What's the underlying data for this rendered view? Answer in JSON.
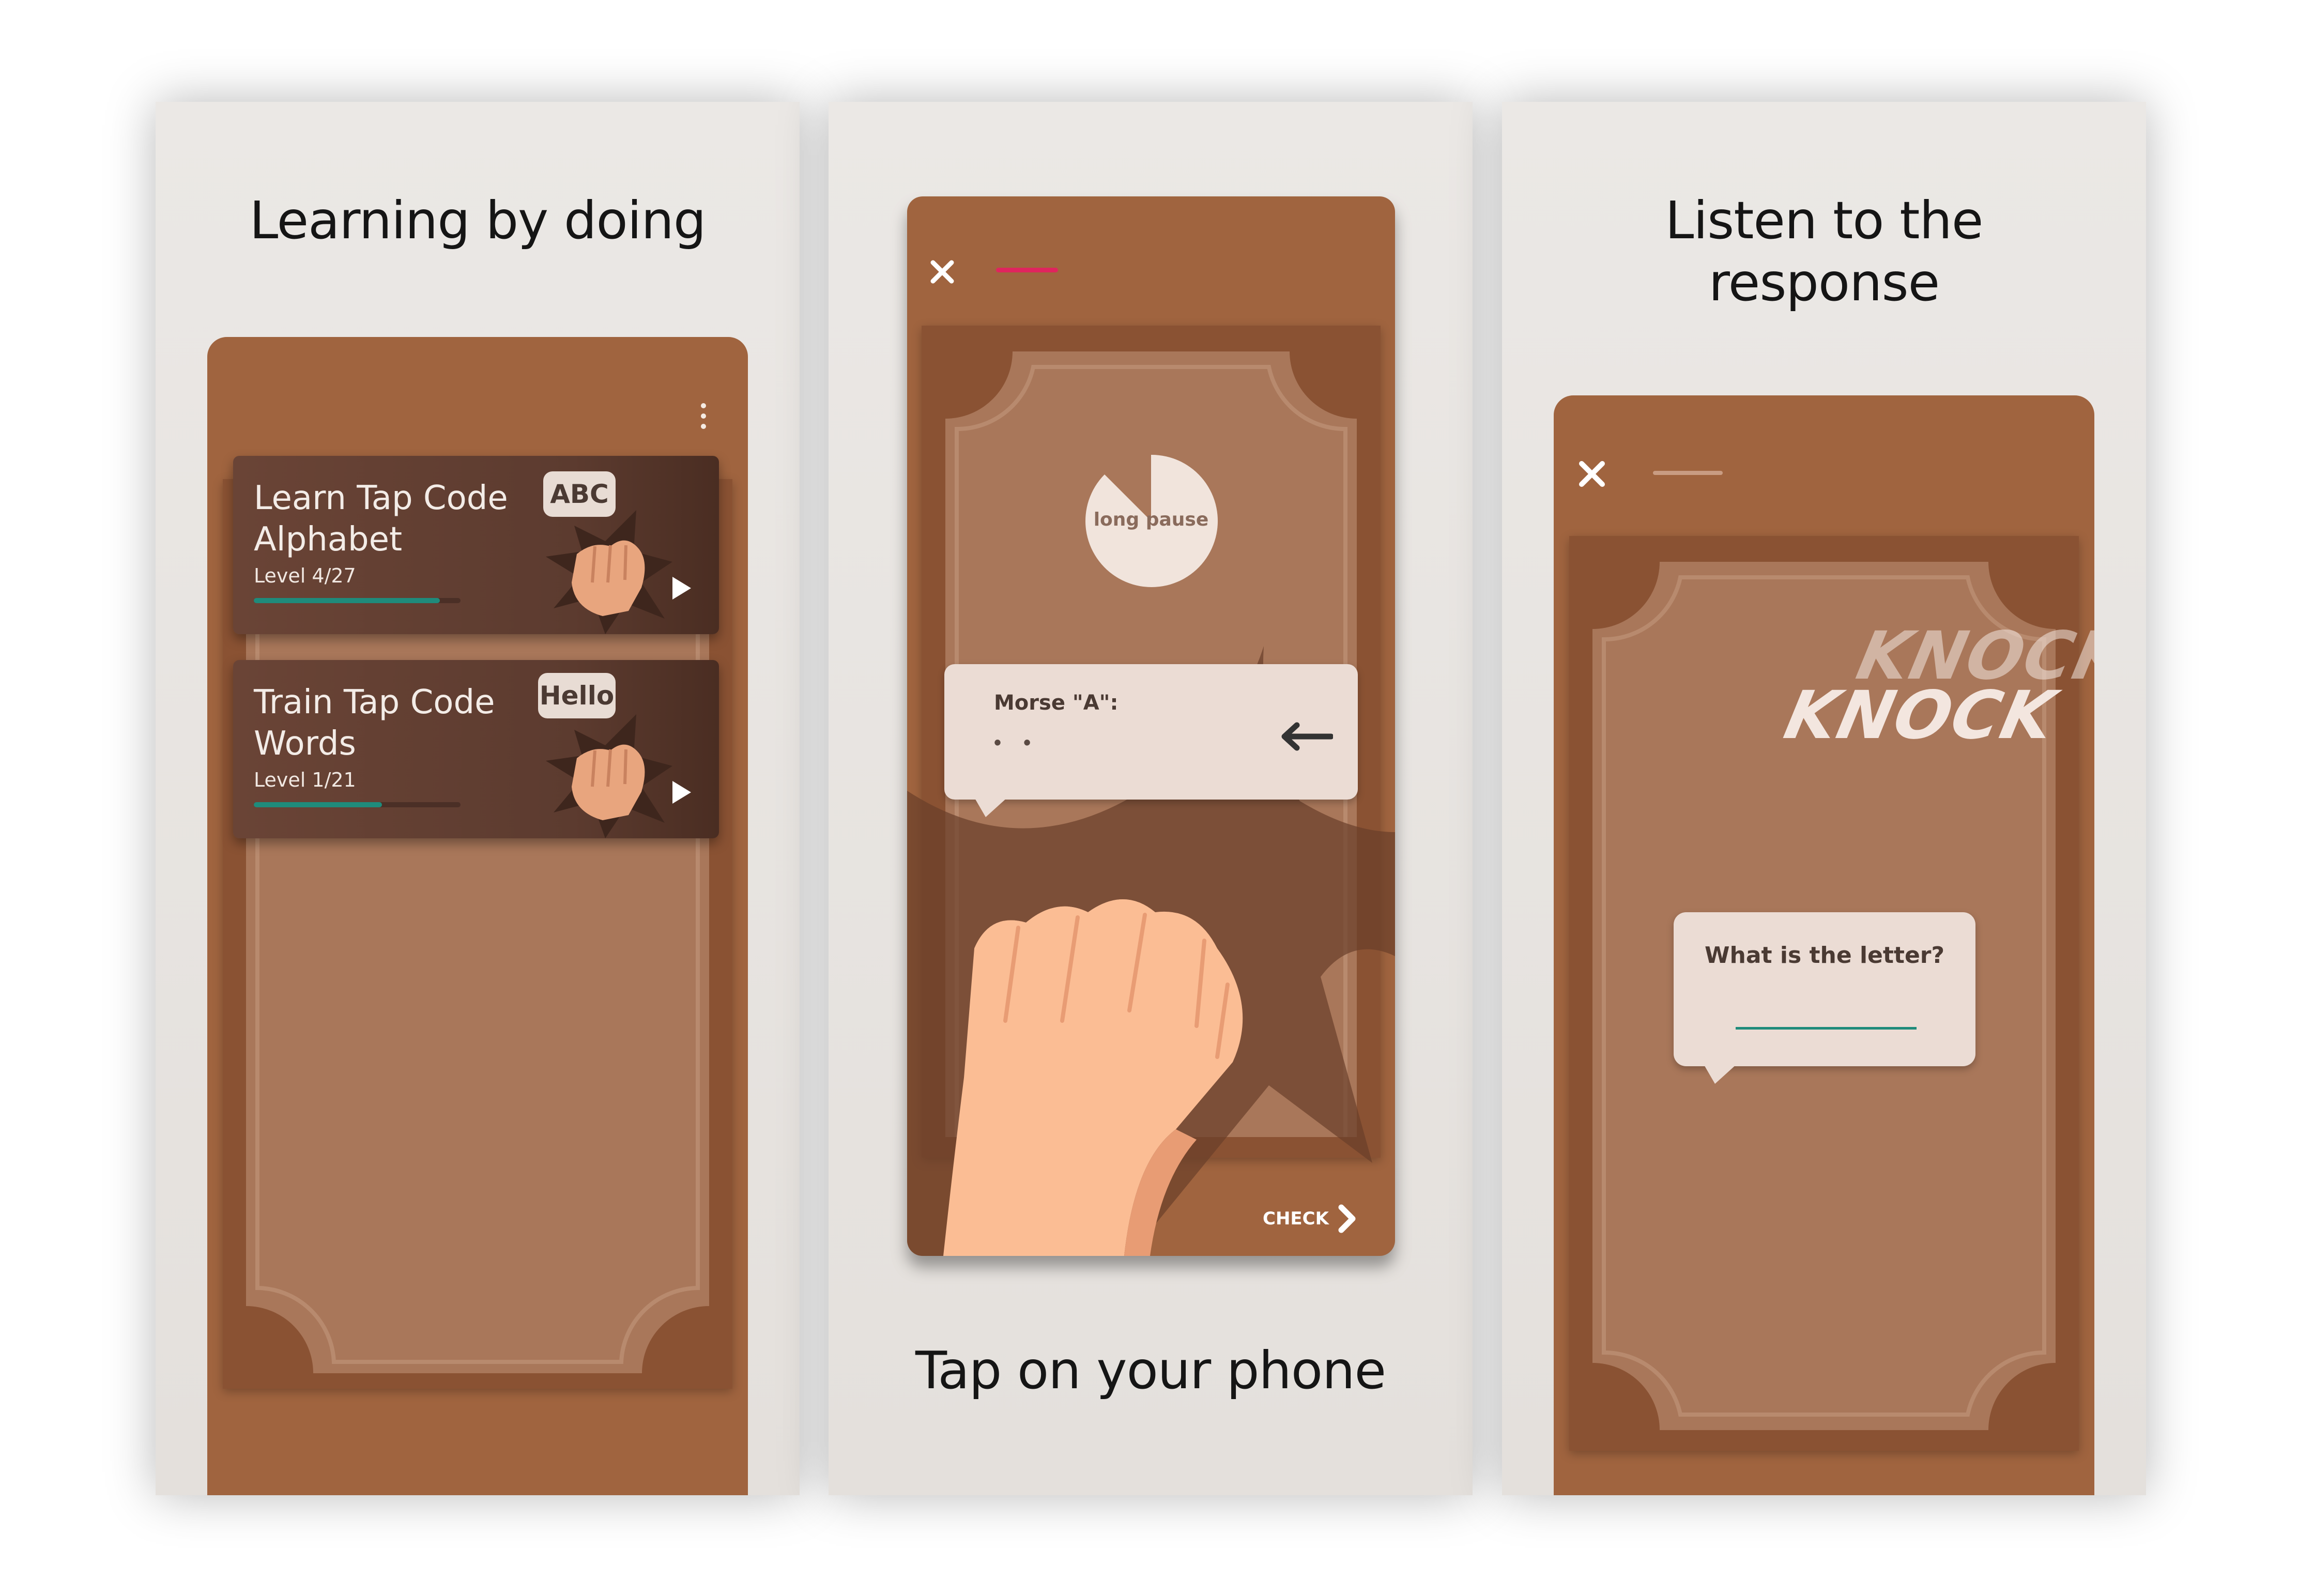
{
  "panels": [
    {
      "caption_lines": [
        "Learning by doing"
      ],
      "courses": [
        {
          "title_lines": [
            "Learn Tap Code",
            "Alphabet"
          ],
          "level": "Level 4/27",
          "badge": "ABC",
          "progress": 0.9
        },
        {
          "title_lines": [
            "Train Tap Code",
            "Words"
          ],
          "level": "Level 1/21",
          "badge": "Hello",
          "progress": 0.62
        }
      ]
    },
    {
      "caption_lines": [
        "Tap on your phone"
      ],
      "timer_label": "long pause",
      "morse_title": "Morse \"A\":",
      "morse_value": "• •",
      "check_label": "CHECK"
    },
    {
      "caption_lines": [
        "Listen to the",
        "response"
      ],
      "knock_1": "KNOCK",
      "knock_2": "KNOCK",
      "question": "What is the letter?"
    }
  ],
  "icons": {
    "menu": "more-vertical-icon",
    "play": "play-icon",
    "close": "close-icon",
    "backspace": "arrow-left-icon",
    "check": "chevron-right-icon"
  },
  "colors": {
    "phone": "#a0643f",
    "frame": "#8a5233",
    "ticket": "#a9775a",
    "card": "#5c3b2f",
    "progress": "#1f8b7b",
    "accent_pink": "#e0245e",
    "bubble": "#ebdcd4",
    "skin": "#fbbd94"
  }
}
